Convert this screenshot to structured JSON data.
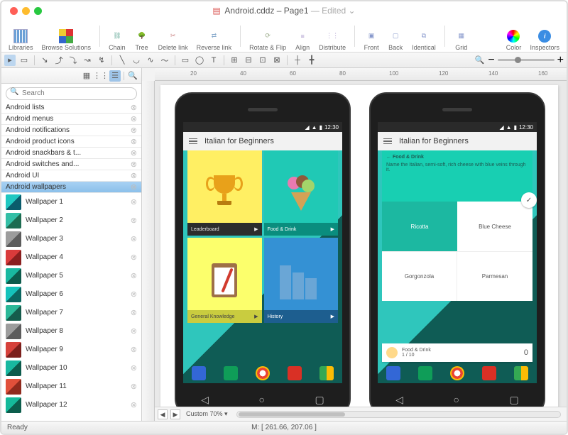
{
  "title": {
    "doc": "Android.cddz",
    "page": "Page1",
    "edited": "— Edited"
  },
  "tl": {
    "close": "#ff5f57",
    "min": "#febc2e",
    "max": "#28c840"
  },
  "toolbar": {
    "libraries": "Libraries",
    "browse": "Browse Solutions",
    "chain": "Chain",
    "tree": "Tree",
    "deletelink": "Delete link",
    "reverselink": "Reverse link",
    "rotate": "Rotate & Flip",
    "align": "Align",
    "distribute": "Distribute",
    "front": "Front",
    "back": "Back",
    "identical": "Identical",
    "grid": "Grid",
    "color": "Color",
    "inspectors": "Inspectors"
  },
  "search": {
    "placeholder": "Search"
  },
  "categories": [
    {
      "label": "Android lists"
    },
    {
      "label": "Android menus"
    },
    {
      "label": "Android notifications"
    },
    {
      "label": "Android product icons"
    },
    {
      "label": "Android snackbars & t..."
    },
    {
      "label": "Android switches and..."
    },
    {
      "label": "Android UI"
    },
    {
      "label": "Android wallpapers",
      "selected": true
    }
  ],
  "wallpapers": [
    {
      "label": "Wallpaper 1"
    },
    {
      "label": "Wallpaper 2"
    },
    {
      "label": "Wallpaper 3"
    },
    {
      "label": "Wallpaper 4"
    },
    {
      "label": "Wallpaper 5"
    },
    {
      "label": "Wallpaper 6"
    },
    {
      "label": "Wallpaper 7"
    },
    {
      "label": "Wallpaper 8"
    },
    {
      "label": "Wallpaper 9"
    },
    {
      "label": "Wallpaper 10"
    },
    {
      "label": "Wallpaper 11"
    },
    {
      "label": "Wallpaper 12"
    }
  ],
  "phone": {
    "time": "12:30",
    "app_title": "Italian for Beginners",
    "tiles": {
      "leaderboard": "Leaderboard",
      "food": "Food & Drink",
      "general": "General Knowledge",
      "history": "History",
      "play": "▶"
    },
    "quiz": {
      "back": "←  Food & Drink",
      "question": "Name the Italian, semi-soft, rich cheese with blue veins through it.",
      "a1": "Ricotta",
      "a2": "Blue Cheese",
      "a3": "Gorgonzola",
      "a4": "Parmesan",
      "foot_cat": "Food & Drink",
      "foot_prog": "1 / 10",
      "score": "0",
      "check": "✓"
    }
  },
  "ruler": {
    "m20": "20",
    "m40": "40",
    "m60": "60",
    "m80": "80",
    "m100": "100",
    "m120": "120",
    "m140": "140",
    "m160": "160"
  },
  "footer": {
    "zoom": "Custom 70%",
    "prev": "◀",
    "next": "▶"
  },
  "status": {
    "ready": "Ready",
    "coords": "M: [ 261.66, 207.06 ]"
  },
  "icons": {
    "signal": "▮",
    "wifi": "▲",
    "batt": "▮",
    "mag": "🔍",
    "minus": "−",
    "plus": "+",
    "tri": "▾"
  }
}
